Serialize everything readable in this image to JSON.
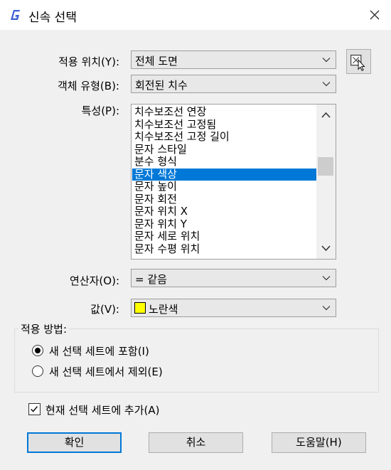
{
  "window": {
    "title": "신속 선택",
    "icon": "app-logo-icon",
    "close_icon": "close-icon"
  },
  "fields": {
    "apply_to": {
      "label": "적용 위치(Y):",
      "value": "전체 도면"
    },
    "object_type": {
      "label": "객체 유형(B):",
      "value": "회전된 치수"
    },
    "properties": {
      "label": "특성(P):",
      "items": [
        "치수보조선 연장",
        "치수보조선 고정됨",
        "치수보조선 고정 길이",
        "문자 스타일",
        "분수 형식",
        "문자 색상",
        "문자 높이",
        "문자 회전",
        "문자 위치 X",
        "문자 위치 Y",
        "문자 세로 위치",
        "문자 수평 위치"
      ],
      "selected": "문자 색상"
    },
    "operator": {
      "label": "연산자(O):",
      "value": "= 같음"
    },
    "value": {
      "label": "값(V):",
      "value": "노란색",
      "swatch_color": "#ffff00"
    }
  },
  "apply_method": {
    "label": "적용 방법:",
    "options": [
      {
        "label": "새 선택 세트에 포함(I)",
        "selected": true
      },
      {
        "label": "새 선택 세트에서 제외(E)",
        "selected": false
      }
    ]
  },
  "append_checkbox": {
    "label": "현재 선택 세트에 추가(A)",
    "checked": true
  },
  "buttons": {
    "ok": "확인",
    "cancel": "취소",
    "help": "도움말(H)"
  },
  "icons": {
    "select_objects": "select-objects-icon",
    "dropdown": "chevron-down-icon",
    "scroll_up": "chevron-up-icon"
  },
  "colors": {
    "selection": "#0078d7",
    "value_swatch": "#ffff00",
    "default_button_border": "#0078d7"
  }
}
